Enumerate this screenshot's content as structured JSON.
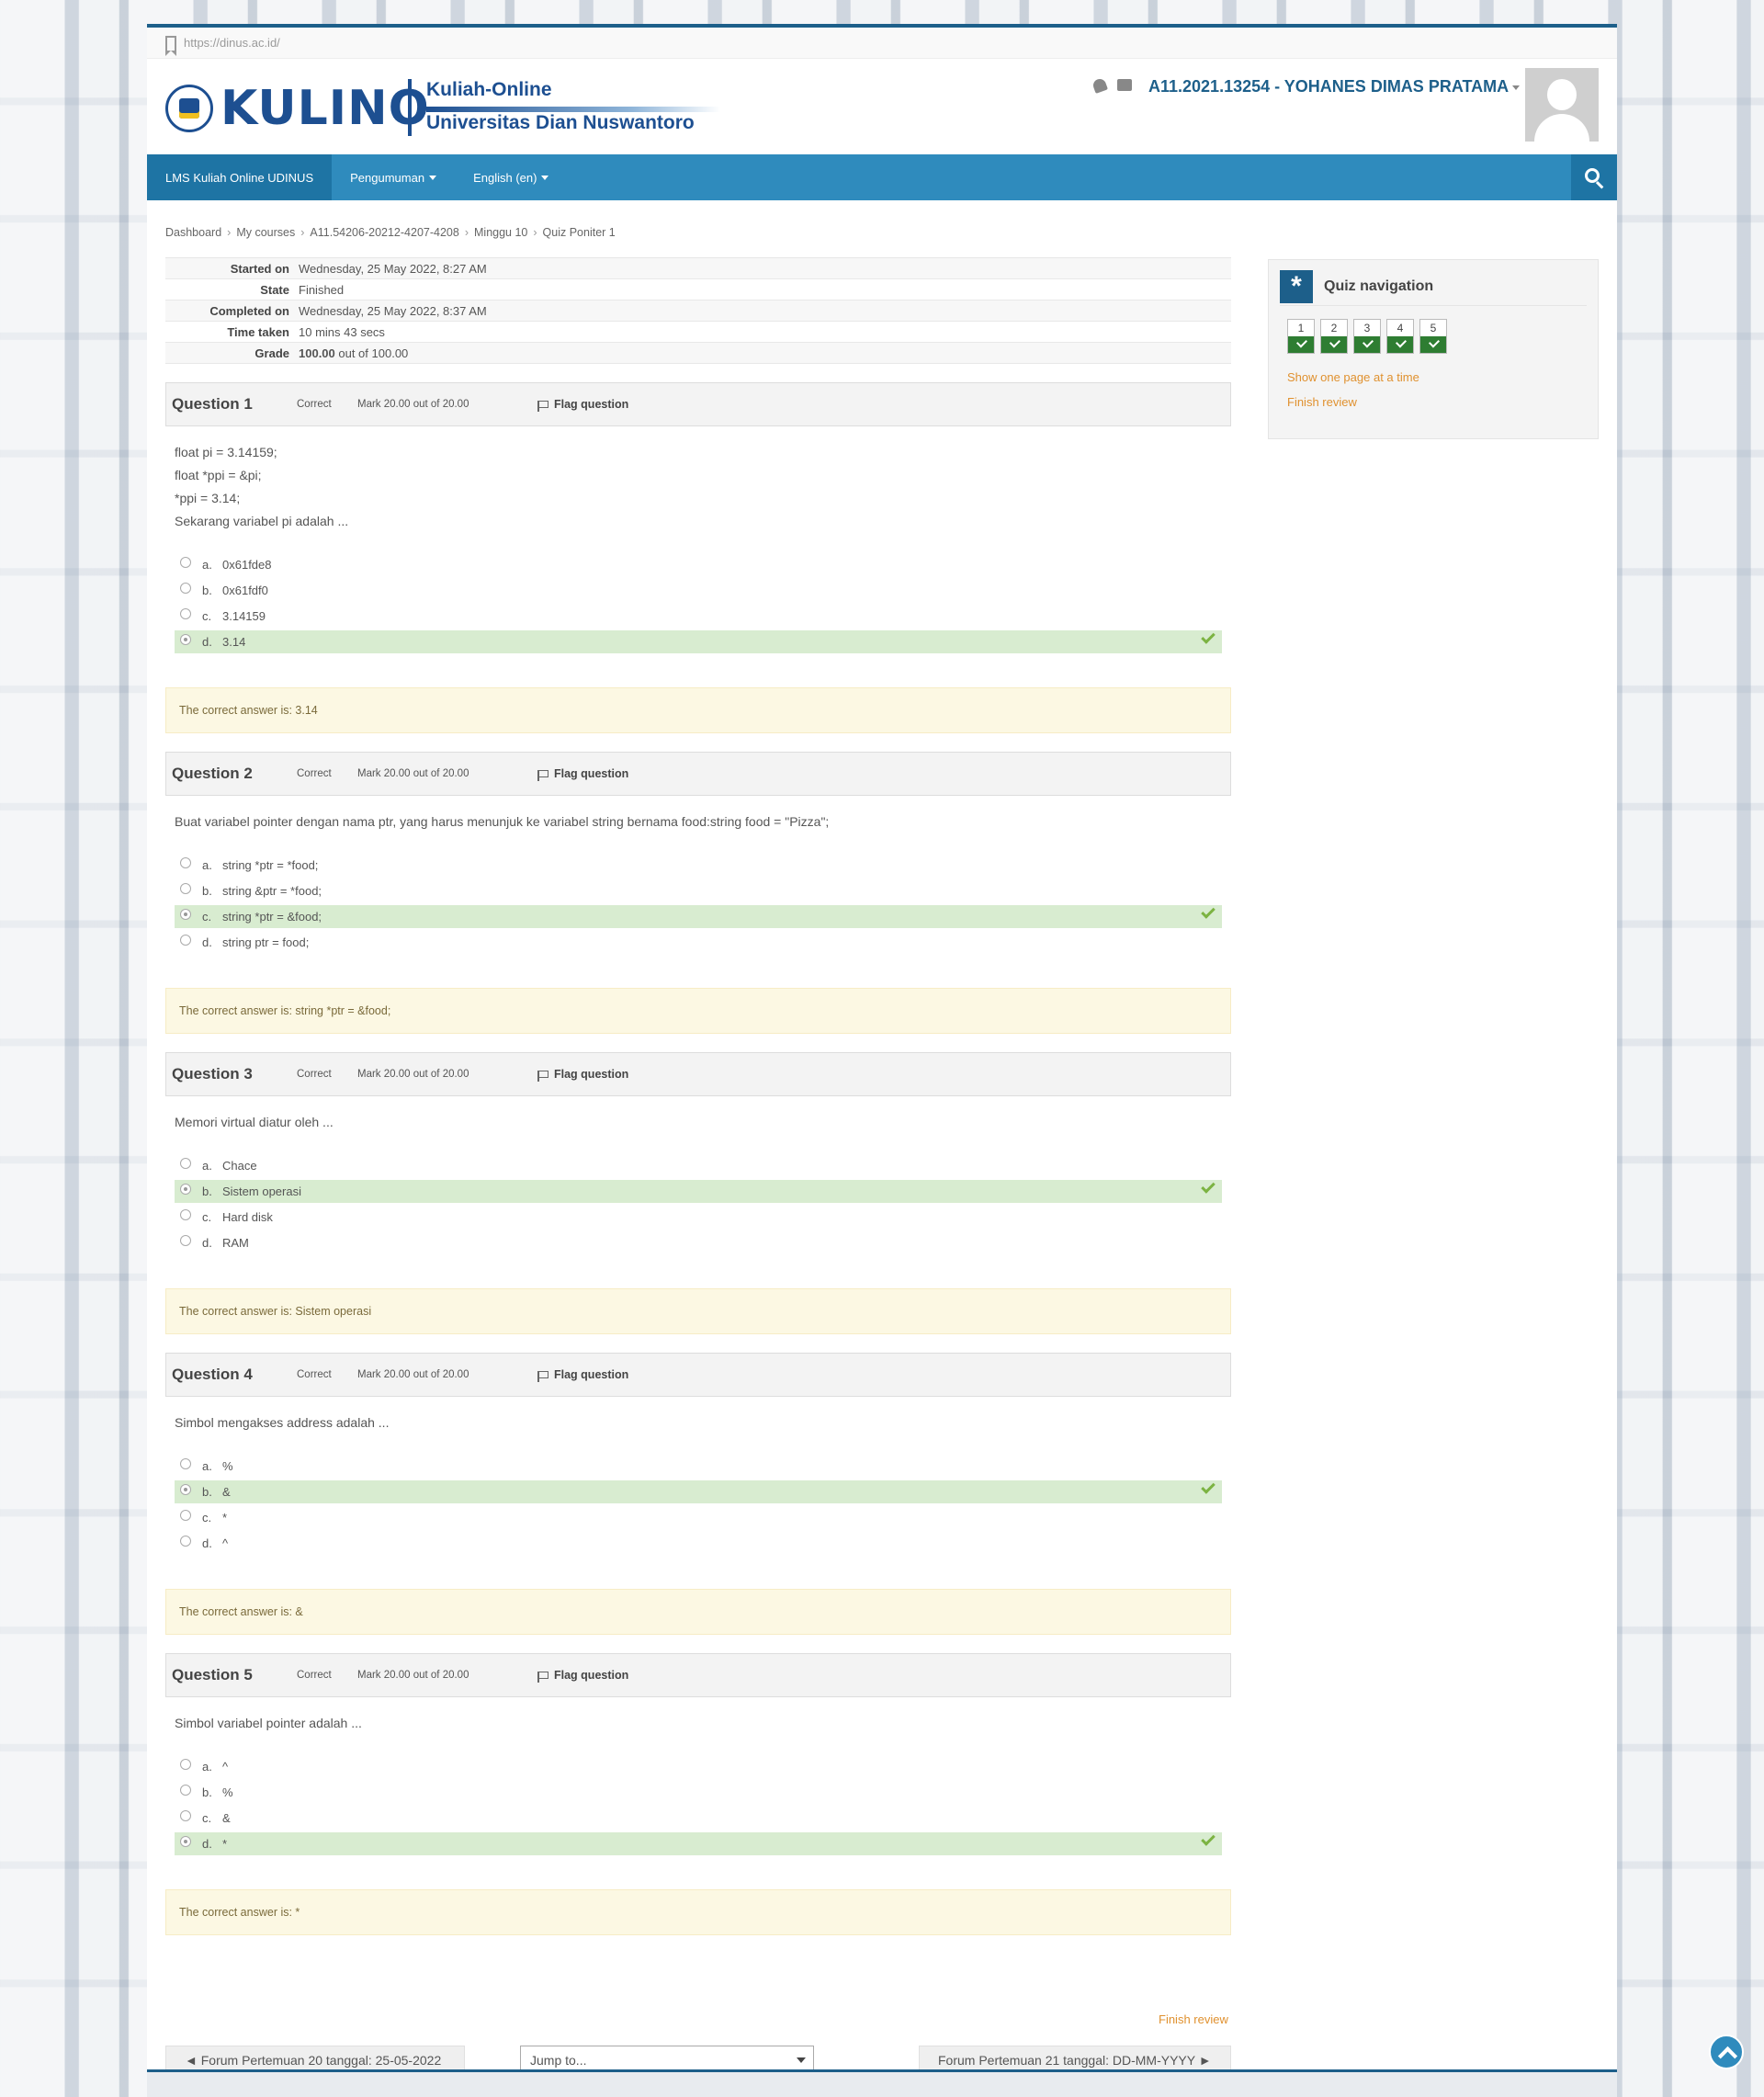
{
  "url": "https://dinus.ac.id/",
  "brand": {
    "word": "KULINO",
    "line1": "Kuliah-Online",
    "line2": "Universitas Dian Nuswantoro"
  },
  "user": {
    "name": "A11.2021.13254 - YOHANES DIMAS PRATAMA"
  },
  "nav": {
    "home": "LMS Kuliah Online UDINUS",
    "announcements": "Pengumuman",
    "language": "English (en)"
  },
  "breadcrumb": [
    "Dashboard",
    "My courses",
    "A11.54206-20212-4207-4208",
    "Minggu 10",
    "Quiz Poniter 1"
  ],
  "summary": [
    {
      "k": "Started on",
      "v": "Wednesday, 25 May 2022, 8:27 AM"
    },
    {
      "k": "State",
      "v": "Finished"
    },
    {
      "k": "Completed on",
      "v": "Wednesday, 25 May 2022, 8:37 AM"
    },
    {
      "k": "Time taken",
      "v": "10 mins 43 secs"
    },
    {
      "k": "Grade",
      "v_bold": "100.00",
      "v_rest": " out of 100.00"
    }
  ],
  "questions": [
    {
      "label": "Question 1",
      "state": "Correct",
      "mark": "Mark 20.00 out of 20.00",
      "flag": "Flag question",
      "text": [
        "float pi = 3.14159;",
        "float *ppi = &pi;",
        "*ppi = 3.14;",
        "Sekarang variabel pi adalah ..."
      ],
      "options": [
        {
          "letter": "a.",
          "text": "0x61fde8",
          "selected": false
        },
        {
          "letter": "b.",
          "text": "0x61fdf0",
          "selected": false
        },
        {
          "letter": "c.",
          "text": "3.14159",
          "selected": false
        },
        {
          "letter": "d.",
          "text": "3.14",
          "selected": true
        }
      ],
      "feedback": "The correct answer is: 3.14"
    },
    {
      "label": "Question 2",
      "state": "Correct",
      "mark": "Mark 20.00 out of 20.00",
      "flag": "Flag question",
      "text": [
        "Buat variabel pointer dengan nama ptr, yang harus menunjuk ke variabel string bernama food:string food = \"Pizza\";"
      ],
      "options": [
        {
          "letter": "a.",
          "text": "string *ptr = *food;",
          "selected": false
        },
        {
          "letter": "b.",
          "text": "string &ptr = *food;",
          "selected": false
        },
        {
          "letter": "c.",
          "text": "string *ptr = &food;",
          "selected": true
        },
        {
          "letter": "d.",
          "text": "string ptr = food;",
          "selected": false
        }
      ],
      "feedback": "The correct answer is: string *ptr = &food;"
    },
    {
      "label": "Question 3",
      "state": "Correct",
      "mark": "Mark 20.00 out of 20.00",
      "flag": "Flag question",
      "text": [
        "Memori virtual diatur oleh ..."
      ],
      "options": [
        {
          "letter": "a.",
          "text": "Chace",
          "selected": false
        },
        {
          "letter": "b.",
          "text": "Sistem operasi",
          "selected": true
        },
        {
          "letter": "c.",
          "text": "Hard disk",
          "selected": false
        },
        {
          "letter": "d.",
          "text": "RAM",
          "selected": false
        }
      ],
      "feedback": "The correct answer is: Sistem operasi"
    },
    {
      "label": "Question 4",
      "state": "Correct",
      "mark": "Mark 20.00 out of 20.00",
      "flag": "Flag question",
      "text": [
        "Simbol mengakses address adalah ..."
      ],
      "options": [
        {
          "letter": "a.",
          "text": "%",
          "selected": false
        },
        {
          "letter": "b.",
          "text": "&",
          "selected": true
        },
        {
          "letter": "c.",
          "text": "*",
          "selected": false
        },
        {
          "letter": "d.",
          "text": "^",
          "selected": false
        }
      ],
      "feedback": "The correct answer is: &"
    },
    {
      "label": "Question 5",
      "state": "Correct",
      "mark": "Mark 20.00 out of 20.00",
      "flag": "Flag question",
      "text": [
        "Simbol variabel pointer adalah ..."
      ],
      "options": [
        {
          "letter": "a.",
          "text": "^",
          "selected": false
        },
        {
          "letter": "b.",
          "text": "%",
          "selected": false
        },
        {
          "letter": "c.",
          "text": "&",
          "selected": false
        },
        {
          "letter": "d.",
          "text": "*",
          "selected": true
        }
      ],
      "feedback": "The correct answer is: *"
    }
  ],
  "quiz_nav": {
    "title": "Quiz navigation",
    "numbers": [
      "1",
      "2",
      "3",
      "4",
      "5"
    ],
    "show_one_page": "Show one page at a time",
    "finish_review": "Finish review"
  },
  "footer": {
    "finish_review": "Finish review",
    "prev": "◄ Forum Pertemuan 20 tanggal: 25-05-2022",
    "jump": "Jump to...",
    "next": "Forum Pertemuan 21 tanggal: DD-MM-YYYY ►"
  },
  "colors": {
    "primary": "#2f8bbd",
    "dark": "#1d5f8a",
    "correct": "#2e7d32",
    "selected_bg": "#d8ecd0",
    "feedback_bg": "#fcf8e3",
    "link": "#e0912f"
  }
}
